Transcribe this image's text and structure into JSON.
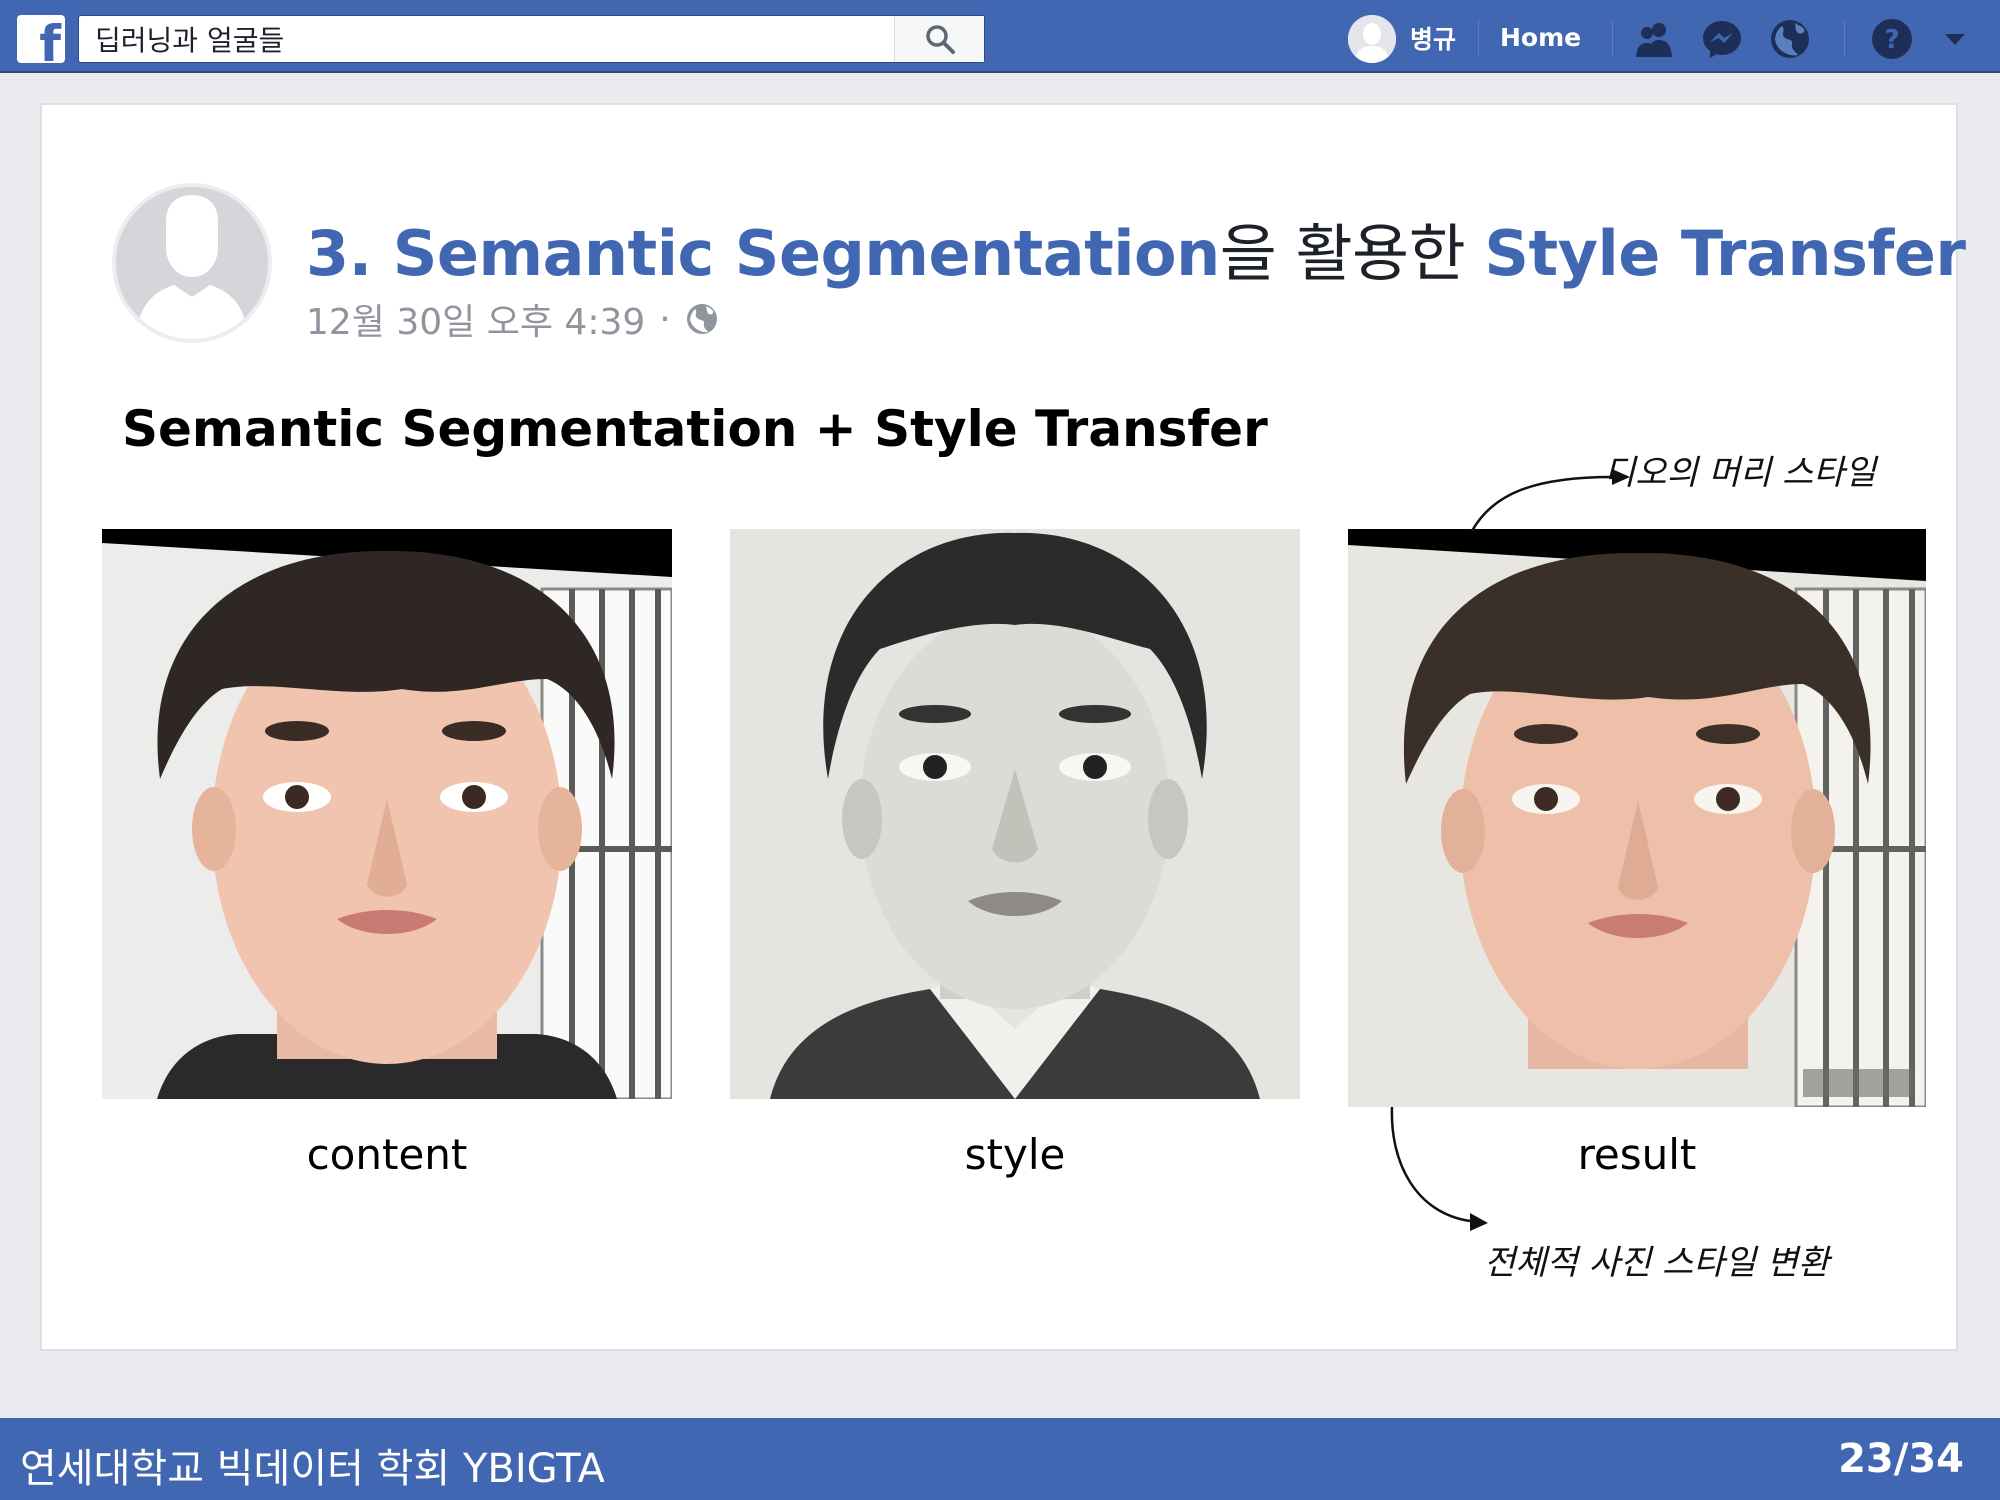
{
  "topbar": {
    "search_value": "딥러닝과 얼굴들",
    "user_name": "병규",
    "home_label": "Home"
  },
  "post": {
    "title_part1": "3. Semantic Segmentation",
    "title_part2": "을 활용한 ",
    "title_part3": "Style Transfer",
    "timestamp": "12월 30일 오후 4:39",
    "meta_separator": "·",
    "heading": "Semantic Segmentation + Style Transfer",
    "captions": [
      "content",
      "style",
      "result"
    ],
    "annotation_top": "디오의 머리 스타일",
    "annotation_bottom": "전체적 사진 스타일 변환"
  },
  "footer": {
    "org": "연세대학교 빅데이터 학회 YBIGTA",
    "page": "23/34"
  },
  "colors": {
    "brand": "#4267b2",
    "title_highlight": "#4267b2",
    "meta_text": "#90949c"
  }
}
